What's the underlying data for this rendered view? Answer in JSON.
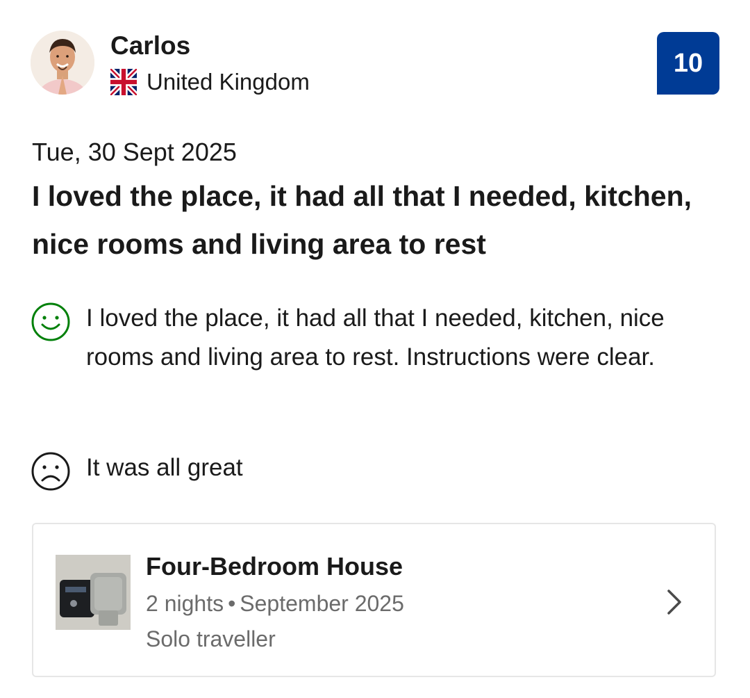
{
  "reviewer": {
    "name": "Carlos",
    "country": "United Kingdom",
    "avatar_icon": "profile-photo",
    "flag_icon": "uk-flag-icon"
  },
  "score": "10",
  "review": {
    "date": "Tue, 30 Sept 2025",
    "title": "I loved the place, it had all that I needed, kitchen, nice rooms and living area to rest",
    "positive": "I loved the place, it had all that I needed, kitchen, nice rooms and living area to rest. Instructions were clear.",
    "negative": "It was all great",
    "positive_icon": "smiley-face-icon",
    "negative_icon": "sad-face-icon"
  },
  "stay": {
    "room_name": "Four-Bedroom House",
    "nights": "2 nights",
    "separator": "•",
    "month": "September 2025",
    "traveller_type": "Solo traveller",
    "chevron_icon": "chevron-right-icon"
  },
  "colors": {
    "score_badge": "#003b95",
    "positive_icon": "#008009",
    "negative_icon": "#1a1a1a",
    "secondary_text": "#6b6b6b",
    "card_border": "#e6e6e6"
  }
}
